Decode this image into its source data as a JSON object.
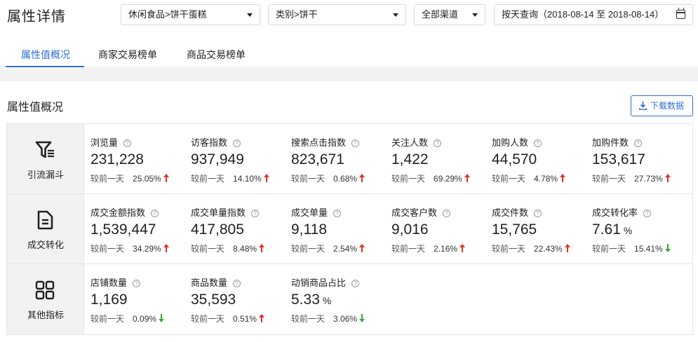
{
  "header": {
    "title": "属性详情",
    "category_select": "休闲食品>饼干蛋糕",
    "type_select": "类别>饼干",
    "channel_select": "全部渠道",
    "date_query": "按天查询（2018-08-14 至 2018-08-14）"
  },
  "tabs": [
    {
      "label": "属性值概况",
      "active": true
    },
    {
      "label": "商家交易榜单",
      "active": false
    },
    {
      "label": "商品交易榜单",
      "active": false
    }
  ],
  "section": {
    "title": "属性值概况",
    "download_label": "下载数据"
  },
  "compare_label": "较前一天",
  "help_glyph": "?",
  "colors": {
    "accent": "#2f6fd6",
    "up": "#e0302b",
    "down": "#3aa83a"
  },
  "rows": [
    {
      "category": "引流漏斗",
      "icon": "funnel-icon",
      "metrics": [
        {
          "name": "浏览量",
          "value": "231,228",
          "unit": "",
          "change": "25.05%",
          "trend": "up"
        },
        {
          "name": "访客指数",
          "value": "937,949",
          "unit": "",
          "change": "14.10%",
          "trend": "up"
        },
        {
          "name": "搜索点击指数",
          "value": "823,671",
          "unit": "",
          "change": "0.68%",
          "trend": "up"
        },
        {
          "name": "关注人数",
          "value": "1,422",
          "unit": "",
          "change": "69.29%",
          "trend": "up"
        },
        {
          "name": "加购人数",
          "value": "44,570",
          "unit": "",
          "change": "4.78%",
          "trend": "up"
        },
        {
          "name": "加购件数",
          "value": "153,617",
          "unit": "",
          "change": "27.73%",
          "trend": "up"
        }
      ]
    },
    {
      "category": "成交转化",
      "icon": "document-icon",
      "metrics": [
        {
          "name": "成交金额指数",
          "value": "1,539,447",
          "unit": "",
          "change": "34.29%",
          "trend": "up"
        },
        {
          "name": "成交单量指数",
          "value": "417,805",
          "unit": "",
          "change": "8.48%",
          "trend": "up"
        },
        {
          "name": "成交单量",
          "value": "9,118",
          "unit": "",
          "change": "2.54%",
          "trend": "up"
        },
        {
          "name": "成交客户数",
          "value": "9,016",
          "unit": "",
          "change": "2.16%",
          "trend": "up"
        },
        {
          "name": "成交件数",
          "value": "15,765",
          "unit": "",
          "change": "22.43%",
          "trend": "up"
        },
        {
          "name": "成交转化率",
          "value": "7.61",
          "unit": "%",
          "change": "15.41%",
          "trend": "down"
        }
      ]
    },
    {
      "category": "其他指标",
      "icon": "grid-icon",
      "metrics": [
        {
          "name": "店铺数量",
          "value": "1,169",
          "unit": "",
          "change": "0.09%",
          "trend": "down"
        },
        {
          "name": "商品数量",
          "value": "35,593",
          "unit": "",
          "change": "0.51%",
          "trend": "up"
        },
        {
          "name": "动销商品占比",
          "value": "5.33",
          "unit": "%",
          "change": "3.06%",
          "trend": "down"
        }
      ]
    }
  ]
}
